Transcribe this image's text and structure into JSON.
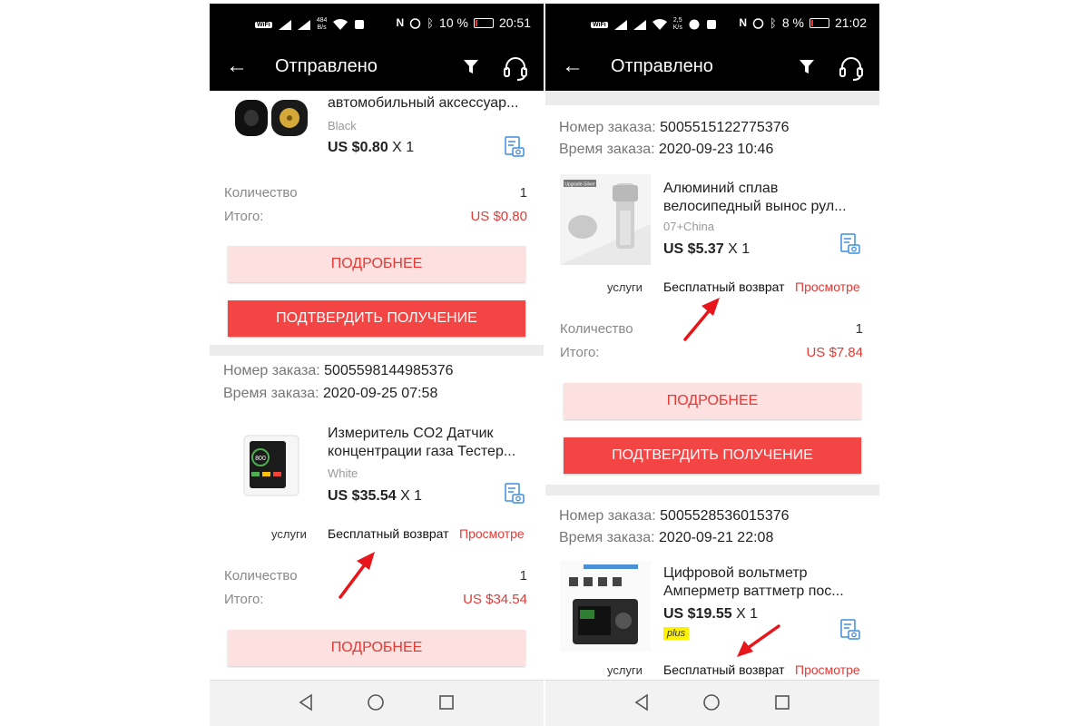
{
  "screens": [
    {
      "status": {
        "speed_top": "484",
        "speed_unit": "B/s",
        "battery": "10 %",
        "battery_level": 0.1,
        "time": "20:51"
      },
      "appbar": {
        "title": "Отправлено"
      },
      "top_card": {
        "product_title": "автомобильный аксессуар...",
        "variant": "Black",
        "price": "US $0.80",
        "qty_suffix": "X 1",
        "quantity_label": "Количество",
        "quantity_value": "1",
        "total_label": "Итого:",
        "total_value": "US $0.80",
        "details_button": "ПОДРОБНЕЕ",
        "confirm_button": "ПОДТВЕРДИТЬ ПОЛУЧЕНИЕ"
      },
      "order": {
        "number_label": "Номер заказа:",
        "number": "5005598144985376",
        "time_label": "Время заказа:",
        "time": "2020-09-25 07:58",
        "product_title": "Измеритель CO2 Датчик концентрации газа Тестер...",
        "variant": "White",
        "price": "US $35.54",
        "qty_suffix": "X 1",
        "services_label": "услуги",
        "services_value": "Бесплатный возврат",
        "services_link": "Просмотре",
        "quantity_label": "Количество",
        "quantity_value": "1",
        "total_label": "Итого:",
        "total_value": "US $34.54",
        "details_button": "ПОДРОБНЕЕ"
      },
      "device_display": "800"
    },
    {
      "status": {
        "speed_top": "2,5",
        "speed_unit": "K/s",
        "battery": "8 %",
        "battery_level": 0.08,
        "time": "21:02"
      },
      "appbar": {
        "title": "Отправлено"
      },
      "order": {
        "number_label": "Номер заказа:",
        "number": "5005515122775376",
        "time_label": "Время заказа:",
        "time": "2020-09-23 10:46",
        "product_title": "Алюминий сплав велосипедный вынос рул...",
        "variant": "07+China",
        "price": "US $5.37",
        "qty_suffix": "X 1",
        "services_label": "услуги",
        "services_value": "Бесплатный возврат",
        "services_link": "Просмотре",
        "quantity_label": "Количество",
        "quantity_value": "1",
        "total_label": "Итого:",
        "total_value": "US $7.84",
        "details_button": "ПОДРОБНЕЕ",
        "confirm_button": "ПОДТВЕРДИТЬ ПОЛУЧЕНИЕ",
        "image_tag": "Upgrade-Silver"
      },
      "order2": {
        "number_label": "Номер заказа:",
        "number": "5005528536015376",
        "time_label": "Время заказа:",
        "time": "2020-09-21 22:08",
        "product_title": "Цифровой вольтметр Амперметр ваттметр пос...",
        "price": "US $19.55",
        "qty_suffix": "X 1",
        "plus_badge": "plus",
        "services_label": "услуги",
        "services_value": "Бесплатный возврат",
        "services_link": "Просмотре"
      }
    }
  ],
  "colors": {
    "accent": "#f44545",
    "accent_light": "#fde1e0",
    "price_red": "#e53935",
    "annotation_arrow": "#e8161b"
  },
  "icons": [
    "back-arrow-icon",
    "filter-icon",
    "headset-icon",
    "photo-review-icon",
    "nav-back-icon",
    "nav-home-icon",
    "nav-recent-icon",
    "wifi-icon",
    "signal-icon",
    "nfc-icon",
    "alarm-icon",
    "bluetooth-icon",
    "battery-icon"
  ]
}
